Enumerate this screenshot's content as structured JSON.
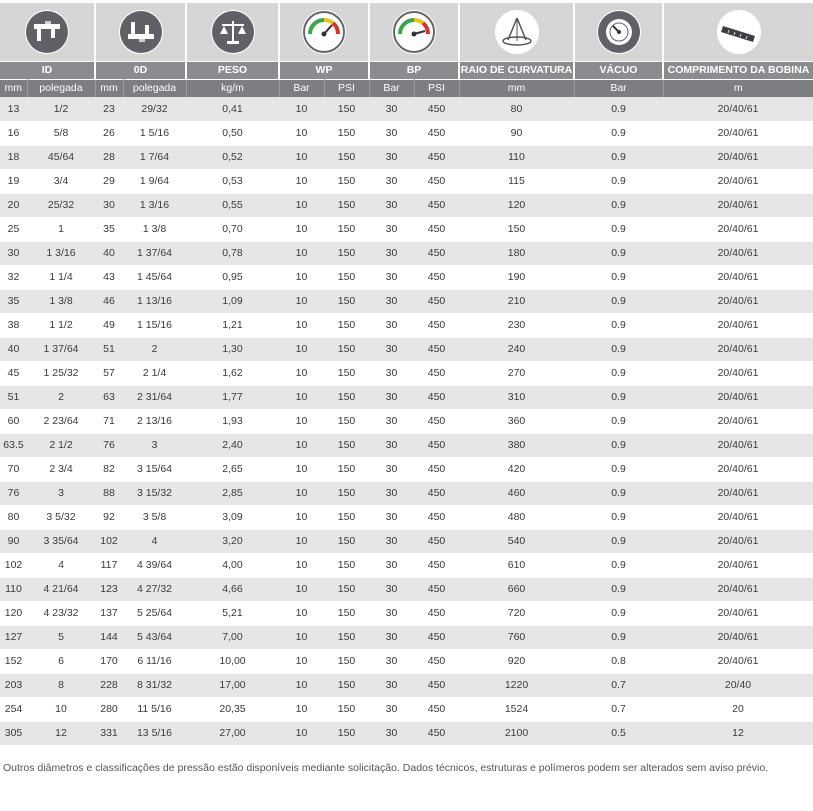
{
  "headers": {
    "icons": [
      "caliper-id-icon",
      "caliper-od-icon",
      "scale-icon",
      "gauge-wp-icon",
      "gauge-bp-icon",
      "bend-radius-icon",
      "vacuum-gauge-icon",
      "tape-measure-icon"
    ],
    "titles": {
      "id": "ID",
      "od": "0D",
      "peso": "PESO",
      "wp": "WP",
      "bp": "BP",
      "raio": "RAIO DE CURVATURA",
      "vacuo": "VÁCUO",
      "comprimento": "COMPRIMENTO DA BOBINA"
    },
    "units": {
      "id_mm": "mm",
      "id_pol": "polegada",
      "od_mm": "mm",
      "od_pol": "polegada",
      "peso": "kg/m",
      "wp_bar": "Bar",
      "wp_psi": "PSI",
      "bp_bar": "Bar",
      "bp_psi": "PSI",
      "raio": "mm",
      "vacuo": "Bar",
      "comprimento": "m"
    }
  },
  "rows": [
    [
      "13",
      "1/2",
      "23",
      "29/32",
      "0,41",
      "10",
      "150",
      "30",
      "450",
      "80",
      "0.9",
      "20/40/61"
    ],
    [
      "16",
      "5/8",
      "26",
      "1 5/16",
      "0,50",
      "10",
      "150",
      "30",
      "450",
      "90",
      "0.9",
      "20/40/61"
    ],
    [
      "18",
      "45/64",
      "28",
      "1 7/64",
      "0,52",
      "10",
      "150",
      "30",
      "450",
      "110",
      "0.9",
      "20/40/61"
    ],
    [
      "19",
      "3/4",
      "29",
      "1 9/64",
      "0,53",
      "10",
      "150",
      "30",
      "450",
      "115",
      "0.9",
      "20/40/61"
    ],
    [
      "20",
      "25/32",
      "30",
      "1 3/16",
      "0,55",
      "10",
      "150",
      "30",
      "450",
      "120",
      "0.9",
      "20/40/61"
    ],
    [
      "25",
      "1",
      "35",
      "1 3/8",
      "0,70",
      "10",
      "150",
      "30",
      "450",
      "150",
      "0.9",
      "20/40/61"
    ],
    [
      "30",
      "1 3/16",
      "40",
      "1 37/64",
      "0,78",
      "10",
      "150",
      "30",
      "450",
      "180",
      "0.9",
      "20/40/61"
    ],
    [
      "32",
      "1 1/4",
      "43",
      "1 45/64",
      "0,95",
      "10",
      "150",
      "30",
      "450",
      "190",
      "0.9",
      "20/40/61"
    ],
    [
      "35",
      "1 3/8",
      "46",
      "1 13/16",
      "1,09",
      "10",
      "150",
      "30",
      "450",
      "210",
      "0.9",
      "20/40/61"
    ],
    [
      "38",
      "1 1/2",
      "49",
      "1 15/16",
      "1,21",
      "10",
      "150",
      "30",
      "450",
      "230",
      "0.9",
      "20/40/61"
    ],
    [
      "40",
      "1 37/64",
      "51",
      "2",
      "1,30",
      "10",
      "150",
      "30",
      "450",
      "240",
      "0.9",
      "20/40/61"
    ],
    [
      "45",
      "1 25/32",
      "57",
      "2 1/4",
      "1,62",
      "10",
      "150",
      "30",
      "450",
      "270",
      "0.9",
      "20/40/61"
    ],
    [
      "51",
      "2",
      "63",
      "2 31/64",
      "1,77",
      "10",
      "150",
      "30",
      "450",
      "310",
      "0.9",
      "20/40/61"
    ],
    [
      "60",
      "2 23/64",
      "71",
      "2 13/16",
      "1,93",
      "10",
      "150",
      "30",
      "450",
      "360",
      "0.9",
      "20/40/61"
    ],
    [
      "63.5",
      "2 1/2",
      "76",
      "3",
      "2,40",
      "10",
      "150",
      "30",
      "450",
      "380",
      "0.9",
      "20/40/61"
    ],
    [
      "70",
      "2 3/4",
      "82",
      "3 15/64",
      "2,65",
      "10",
      "150",
      "30",
      "450",
      "420",
      "0.9",
      "20/40/61"
    ],
    [
      "76",
      "3",
      "88",
      "3 15/32",
      "2,85",
      "10",
      "150",
      "30",
      "450",
      "460",
      "0.9",
      "20/40/61"
    ],
    [
      "80",
      "3 5/32",
      "92",
      "3 5/8",
      "3,09",
      "10",
      "150",
      "30",
      "450",
      "480",
      "0.9",
      "20/40/61"
    ],
    [
      "90",
      "3 35/64",
      "102",
      "4",
      "3,20",
      "10",
      "150",
      "30",
      "450",
      "540",
      "0.9",
      "20/40/61"
    ],
    [
      "102",
      "4",
      "117",
      "4 39/64",
      "4,00",
      "10",
      "150",
      "30",
      "450",
      "610",
      "0.9",
      "20/40/61"
    ],
    [
      "110",
      "4 21/64",
      "123",
      "4 27/32",
      "4,66",
      "10",
      "150",
      "30",
      "450",
      "660",
      "0.9",
      "20/40/61"
    ],
    [
      "120",
      "4 23/32",
      "137",
      "5 25/64",
      "5,21",
      "10",
      "150",
      "30",
      "450",
      "720",
      "0.9",
      "20/40/61"
    ],
    [
      "127",
      "5",
      "144",
      "5 43/64",
      "7,00",
      "10",
      "150",
      "30",
      "450",
      "760",
      "0.9",
      "20/40/61"
    ],
    [
      "152",
      "6",
      "170",
      "6 11/16",
      "10,00",
      "10",
      "150",
      "30",
      "450",
      "920",
      "0.8",
      "20/40/61"
    ],
    [
      "203",
      "8",
      "228",
      "8 31/32",
      "17,00",
      "10",
      "150",
      "30",
      "450",
      "1220",
      "0.7",
      "20/40"
    ],
    [
      "254",
      "10",
      "280",
      "11 5/16",
      "20,35",
      "10",
      "150",
      "30",
      "450",
      "1524",
      "0.7",
      "20"
    ],
    [
      "305",
      "12",
      "331",
      "13 5/16",
      "27,00",
      "10",
      "150",
      "30",
      "450",
      "2100",
      "0.5",
      "12"
    ]
  ],
  "footnote": "Outros diâmetros e classificações de pressão estão disponíveis mediante solicitação. Dados técnicos, estruturas e polímeros podem ser alterados sem aviso prévio."
}
